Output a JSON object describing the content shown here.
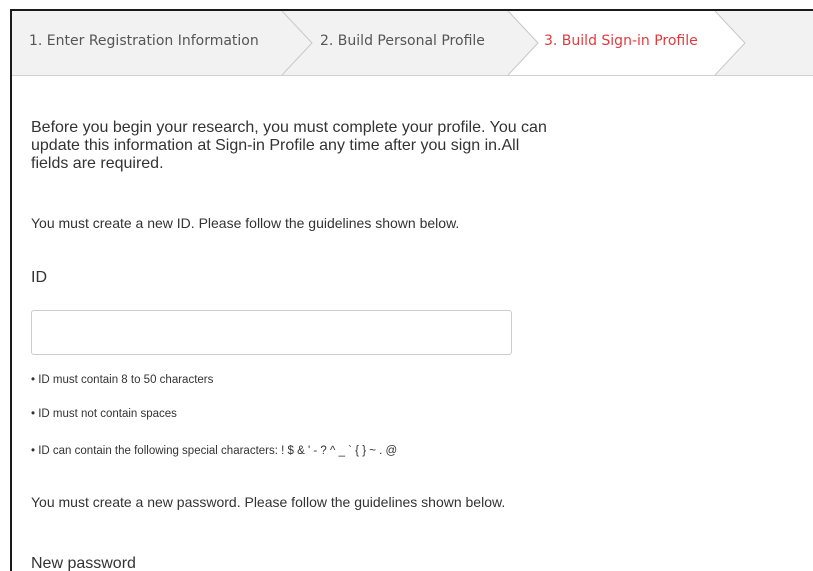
{
  "steps": [
    {
      "label": "1. Enter Registration Information",
      "active": false
    },
    {
      "label": "2. Build Personal Profile",
      "active": false
    },
    {
      "label": "3. Build Sign-in Profile",
      "active": true
    }
  ],
  "colors": {
    "active_step": "#e03a3e",
    "inactive_step": "#555555",
    "steps_background": "#f2f2f2",
    "text": "#333333"
  },
  "content": {
    "intro": "Before you begin your research, you must complete your profile. You can update this information at Sign-in Profile any time after you sign in.All fields are required.",
    "id_note": "You must create a new ID. Please follow the guidelines shown below.",
    "id_label": "ID",
    "id_value": "",
    "id_rules": [
      "• ID must contain 8 to 50 characters",
      "• ID must not contain spaces",
      "• ID can contain the following special characters: ! $ & ' - ? ^ _ ` { } ~ . @"
    ],
    "password_note": "You must create a new password. Please follow the guidelines shown below.",
    "password_label": "New password"
  }
}
